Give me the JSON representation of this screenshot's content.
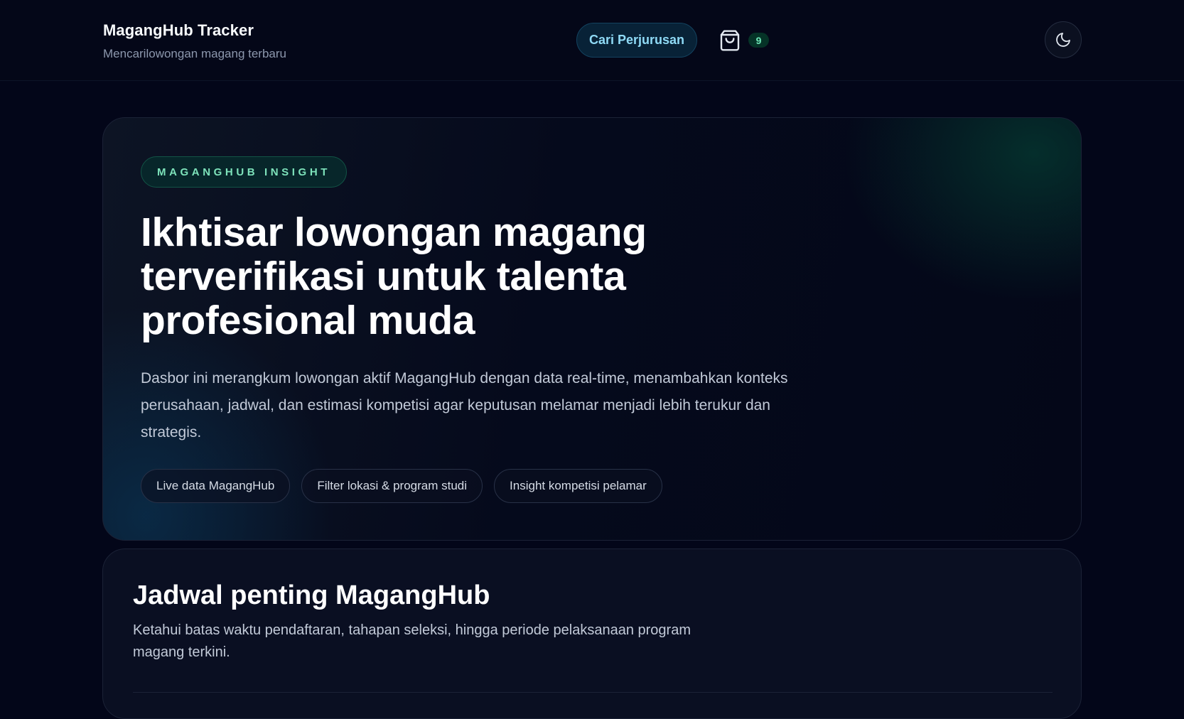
{
  "header": {
    "brand_title": "MagangHub Tracker",
    "brand_subtitle": "Mencarilowongan magang terbaru",
    "cari_label": "Cari Perjurusan",
    "cart_icon": "shopping-bag-icon",
    "cart_count": "9",
    "theme_icon": "moon-icon"
  },
  "hero": {
    "badge": "MAGANGHUB INSIGHT",
    "title": "Ikhtisar lowongan magang terverifikasi untuk talenta profesional muda",
    "description": "Dasbor ini merangkum lowongan aktif MagangHub dengan data real-time, menambahkan konteks perusahaan, jadwal, dan estimasi kompetisi agar keputusan melamar menjadi lebih terukur dan strategis.",
    "chips": [
      "Live data MagangHub",
      "Filter lokasi & program studi",
      "Insight kompetisi pelamar"
    ]
  },
  "schedule": {
    "title": "Jadwal penting MagangHub",
    "description": "Ketahui batas waktu pendaftaran, tahapan seleksi, hingga periode pelaksanaan program magang terkini."
  },
  "colors": {
    "background": "#030619",
    "accent_cyan": "#8fdaf6",
    "accent_green": "#7ee3bb",
    "badge_green": "#6ee7b7"
  }
}
